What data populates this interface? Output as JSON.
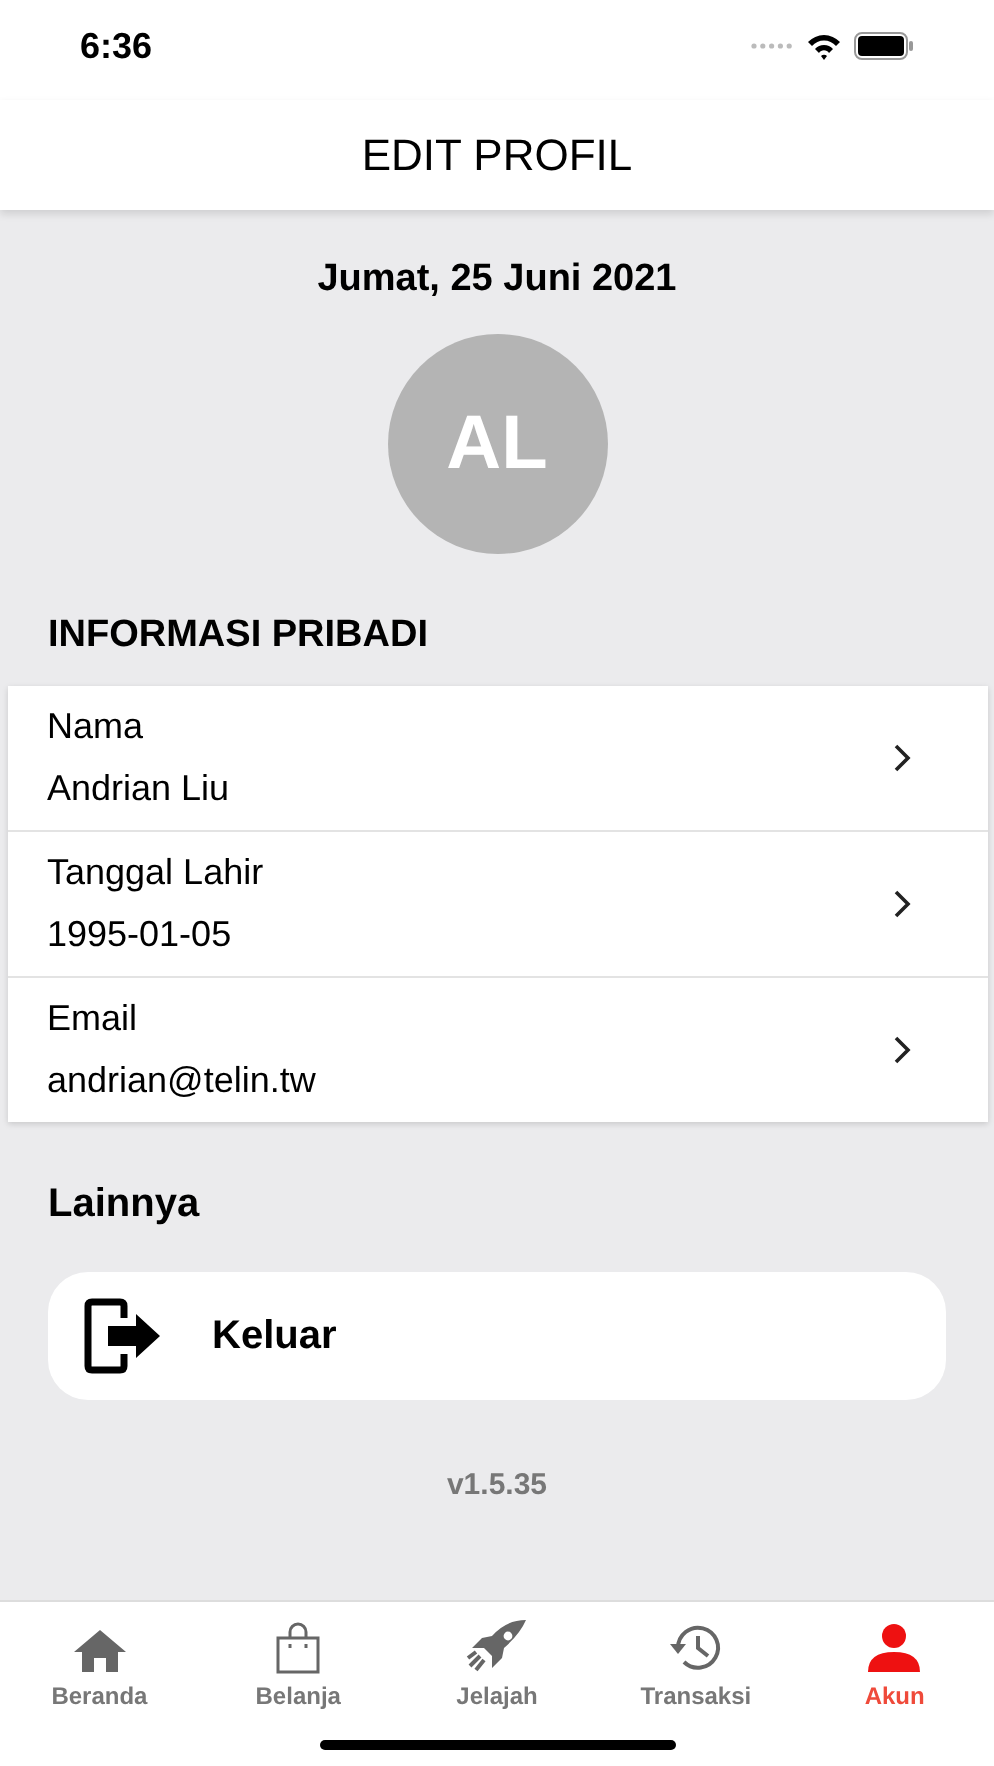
{
  "status_bar": {
    "time": "6:36"
  },
  "header": {
    "title": "EDIT PROFIL"
  },
  "date": "Jumat, 25 Juni 2021",
  "avatar": {
    "initials": "AL"
  },
  "personal_info": {
    "title": "INFORMASI PRIBADI",
    "rows": [
      {
        "label": "Nama",
        "value": "Andrian Liu"
      },
      {
        "label": "Tanggal Lahir",
        "value": "1995-01-05"
      },
      {
        "label": "Email",
        "value": "andrian@telin.tw"
      }
    ]
  },
  "other": {
    "title": "Lainnya",
    "logout_label": "Keluar"
  },
  "version": "v1.5.35",
  "tabs": [
    {
      "kind": "home",
      "label": "Beranda",
      "selected": false
    },
    {
      "kind": "bag",
      "label": "Belanja",
      "selected": false
    },
    {
      "kind": "rocket",
      "label": "Jelajah",
      "selected": false
    },
    {
      "kind": "history",
      "label": "Transaksi",
      "selected": false
    },
    {
      "kind": "person",
      "label": "Akun",
      "selected": true
    }
  ]
}
